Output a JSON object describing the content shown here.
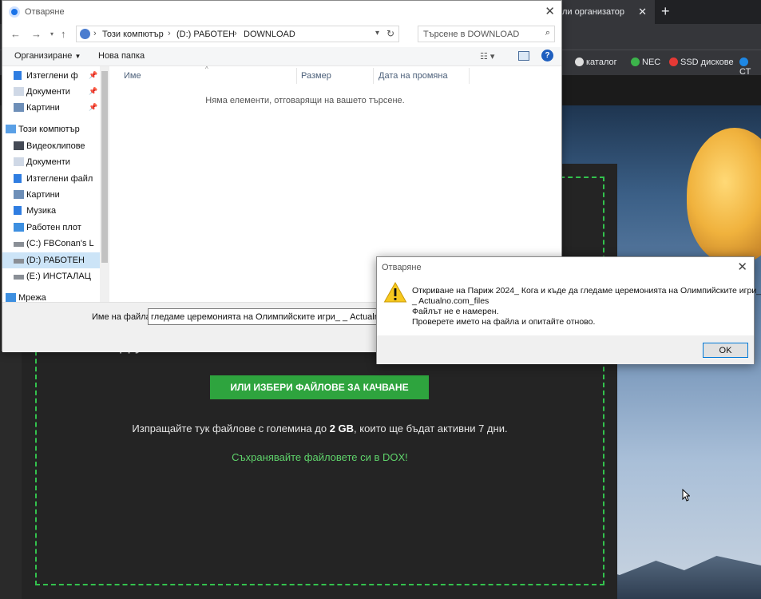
{
  "browser": {
    "active_tab": "ли организатор",
    "bookmarks": [
      {
        "label": "каталог",
        "color": "#dddddd"
      },
      {
        "label": "NEC",
        "color": "#3cb44b"
      },
      {
        "label": "SSD дискове",
        "color": "#e53935"
      },
      {
        "label": "СТ",
        "color": "#1e88e5"
      }
    ]
  },
  "site": {
    "heading_partial": "д                        у",
    "upload_button": "ИЛИ ИЗБЕРИ ФАЙЛОВЕ ЗА КАЧВАНЕ",
    "info_before": "Изпращайте тук файлове с големина до ",
    "info_size": "2 GB",
    "info_after": ", които ще бъдат активни 7 дни.",
    "dox_link": "Съхранявайте файловете си в DOX!"
  },
  "open_dialog": {
    "title": "Отваряне",
    "breadcrumbs": [
      "Този компютър",
      "(D:) РАБОТЕН",
      "DOWNLOAD"
    ],
    "search_placeholder": "Търсене в DOWNLOAD",
    "organize": "Организиране",
    "new_folder": "Нова папка",
    "columns": [
      "Име",
      "Размер",
      "Дата на промяна"
    ],
    "empty_message": "Няма елементи, отговарящи на вашето търсене.",
    "nav_items": [
      {
        "label": "Изтеглени ф",
        "icon": "download-icon",
        "pinned": true
      },
      {
        "label": "Документи",
        "icon": "document-icon",
        "pinned": true
      },
      {
        "label": "Картини",
        "icon": "pictures-icon",
        "pinned": true
      },
      {
        "label": "Този компютър",
        "icon": "computer-icon",
        "pinned": false
      },
      {
        "label": "Видеоклипове",
        "icon": "video-icon",
        "pinned": false
      },
      {
        "label": "Документи",
        "icon": "document-icon",
        "pinned": false
      },
      {
        "label": "Изтеглени файл",
        "icon": "download-icon",
        "pinned": false
      },
      {
        "label": "Картини",
        "icon": "pictures-icon",
        "pinned": false
      },
      {
        "label": "Музика",
        "icon": "music-icon",
        "pinned": false
      },
      {
        "label": "Работен плот",
        "icon": "desktop-icon",
        "pinned": false
      },
      {
        "label": "(C:) FBConan's L",
        "icon": "drive-icon",
        "pinned": false
      },
      {
        "label": "(D:) РАБОТЕН",
        "icon": "drive-icon",
        "pinned": false,
        "selected": true
      },
      {
        "label": "(E:) ИНСТАЛАЦ",
        "icon": "drive-icon",
        "pinned": false
      },
      {
        "label": "Мрежа",
        "icon": "network-icon",
        "pinned": false
      }
    ],
    "filename_label": "Име на файла:",
    "filename_value": "гледаме церемонията на Олимпийските игри_ _ Actualno.com_files"
  },
  "error_dialog": {
    "title": "Отваряне",
    "lines": [
      "Откриване на Париж 2024_ Кога и къде да гледаме церемонията на Олимпийските игри_",
      "_ Actualno.com_files",
      "Файлът не е намерен.",
      "Проверете името на файла и опитайте отново."
    ],
    "ok": "OK"
  },
  "colors": {
    "accent_green": "#2ea43e",
    "dashed_border": "#33c24d",
    "dox_link": "#5fd36b",
    "selection": "#cce4f7"
  }
}
